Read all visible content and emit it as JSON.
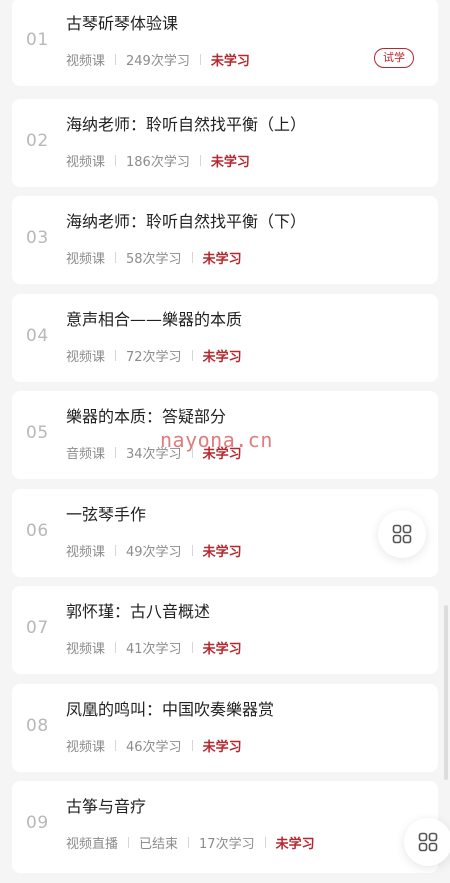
{
  "lessons": [
    {
      "num": "01",
      "title": "古琴斫琴体验课",
      "type": "视频课",
      "count": "249次学习",
      "status": "未学习",
      "badge": "试学"
    },
    {
      "num": "02",
      "title": "海纳老师：聆听自然找平衡（上）",
      "type": "视频课",
      "count": "186次学习",
      "status": "未学习"
    },
    {
      "num": "03",
      "title": "海纳老师：聆听自然找平衡（下）",
      "type": "视频课",
      "count": "58次学习",
      "status": "未学习"
    },
    {
      "num": "04",
      "title": "意声相合——樂器的本质",
      "type": "视频课",
      "count": "72次学习",
      "status": "未学习"
    },
    {
      "num": "05",
      "title": "樂器的本质：答疑部分",
      "type": "音频课",
      "count": "34次学习",
      "status": "未学习"
    },
    {
      "num": "06",
      "title": "一弦琴手作",
      "type": "视频课",
      "count": "49次学习",
      "status": "未学习"
    },
    {
      "num": "07",
      "title": "郭怀瑾：古八音概述",
      "type": "视频课",
      "count": "41次学习",
      "status": "未学习"
    },
    {
      "num": "08",
      "title": "凤凰的鸣叫：中国吹奏樂器赏",
      "type": "视频课",
      "count": "46次学习",
      "status": "未学习"
    },
    {
      "num": "09",
      "title": "古筝与音疗",
      "type": "视频直播",
      "state": "已结束",
      "count": "17次学习",
      "status": "未学习"
    }
  ],
  "watermark": "nayona.cn",
  "float_button_icon": "grid-icon",
  "colors": {
    "accent": "#b5282e",
    "muted": "#8c8c8c",
    "number": "#b8b8b8"
  }
}
